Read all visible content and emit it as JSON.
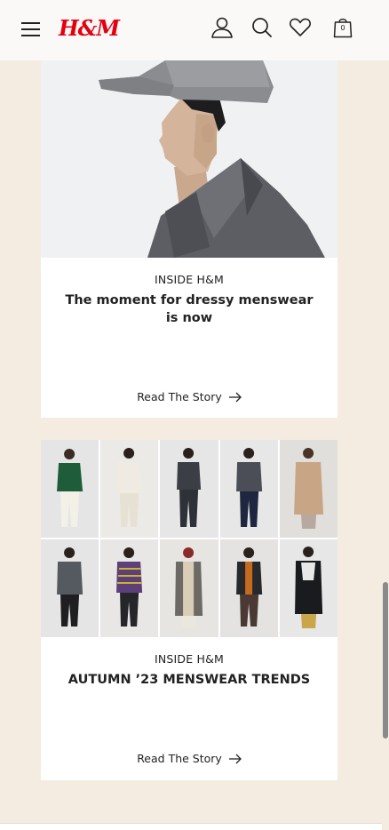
{
  "header": {
    "menu_icon": "hamburger-menu-icon",
    "logo_text": "H&M",
    "logo_color": "#e50010",
    "account_icon": "user-icon",
    "search_icon": "search-icon",
    "favorites_icon": "heart-icon",
    "bag_icon": "shopping-bag-icon",
    "bag_count": "0"
  },
  "articles": [
    {
      "category": "INSIDE H&M",
      "title": "The moment for dressy menswear is now",
      "link_label": "Read The Story",
      "link_icon": "arrow-right-icon",
      "image": "photo-man-in-grey-cap-profile"
    },
    {
      "category": "INSIDE H&M",
      "title": "AUTUMN ’23 MENSWEAR TRENDS",
      "link_label": "Read The Story",
      "link_icon": "arrow-right-icon",
      "image": "photo-grid-ten-menswear-looks"
    }
  ],
  "colors": {
    "page_background": "#f4ece0",
    "header_background": "#faf9f8",
    "card_background": "#ffffff",
    "text": "#222222"
  }
}
